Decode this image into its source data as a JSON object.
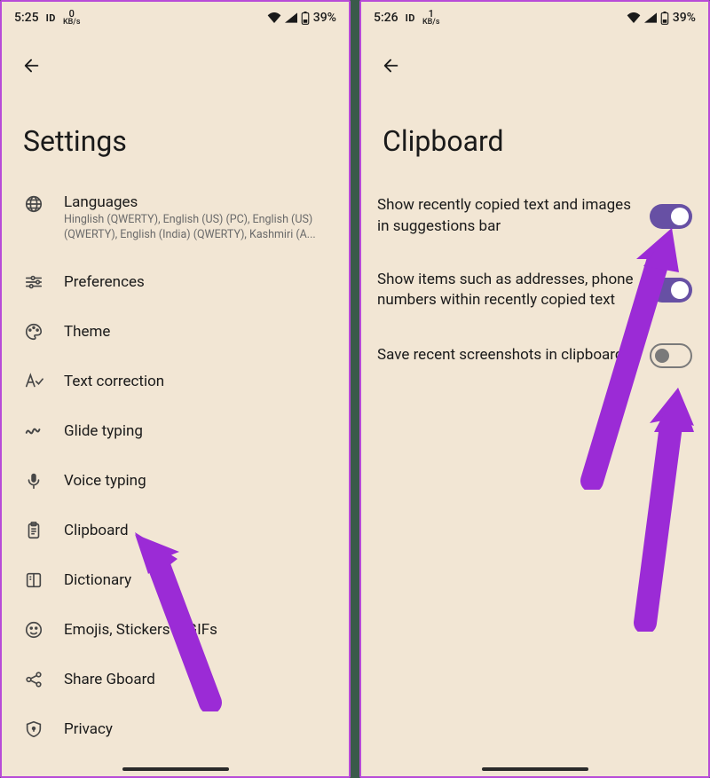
{
  "left": {
    "status": {
      "time": "5:25",
      "net_val": "0",
      "net_unit": "KB/s",
      "battery": "39%"
    },
    "title": "Settings",
    "items": [
      {
        "icon": "globe-icon",
        "label": "Languages",
        "sub": "Hinglish (QWERTY), English (US) (PC), English (US) (QWERTY), English (India) (QWERTY), Kashmiri (A..."
      },
      {
        "icon": "sliders-icon",
        "label": "Preferences"
      },
      {
        "icon": "palette-icon",
        "label": "Theme"
      },
      {
        "icon": "text-correction-icon",
        "label": "Text correction"
      },
      {
        "icon": "glide-icon",
        "label": "Glide typing"
      },
      {
        "icon": "mic-icon",
        "label": "Voice typing"
      },
      {
        "icon": "clipboard-icon",
        "label": "Clipboard"
      },
      {
        "icon": "dictionary-icon",
        "label": "Dictionary"
      },
      {
        "icon": "emoji-icon",
        "label": "Emojis, Stickers & GIFs"
      },
      {
        "icon": "share-icon",
        "label": "Share Gboard"
      },
      {
        "icon": "shield-icon",
        "label": "Privacy"
      }
    ]
  },
  "right": {
    "status": {
      "time": "5:26",
      "net_val": "1",
      "net_unit": "KB/s",
      "battery": "39%"
    },
    "title": "Clipboard",
    "items": [
      {
        "label": "Show recently copied text and images in suggestions bar",
        "on": true
      },
      {
        "label": "Show items such as addresses, phone numbers within recently copied text",
        "on": true
      },
      {
        "label": "Save recent screenshots in clipboard",
        "on": false
      }
    ]
  },
  "annotations": {
    "arrow_color": "#9b2bd6"
  }
}
